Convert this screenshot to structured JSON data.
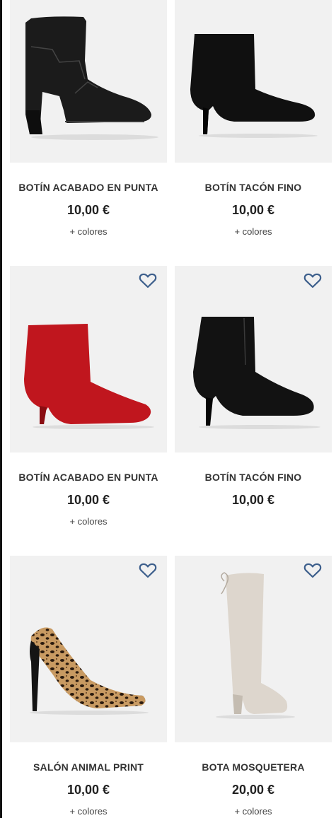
{
  "products": [
    {
      "name": "BOTÍN ACABADO EN PUNTA",
      "price": "10,00 €",
      "colors_label": "+ colores",
      "image": "black-cowboy-ankle-boot",
      "favorite_icon": false,
      "color": "#1a1a1a"
    },
    {
      "name": "BOTÍN TACÓN FINO",
      "price": "10,00 €",
      "colors_label": "+ colores",
      "image": "black-suede-stiletto-ankle-boot",
      "favorite_icon": false,
      "color": "#111111"
    },
    {
      "name": "BOTÍN ACABADO EN PUNTA",
      "price": "10,00 €",
      "colors_label": "+ colores",
      "image": "red-suede-pointed-ankle-boot",
      "favorite_icon": true,
      "color": "#c0161e"
    },
    {
      "name": "BOTÍN TACÓN FINO",
      "price": "10,00 €",
      "colors_label": "",
      "image": "black-leather-stiletto-ankle-boot",
      "favorite_icon": true,
      "color": "#121212"
    },
    {
      "name": "SALÓN ANIMAL PRINT",
      "price": "10,00 €",
      "colors_label": "+ colores",
      "image": "leopard-print-pump",
      "favorite_icon": true,
      "color": "#b58a5a"
    },
    {
      "name": "BOTA MOSQUETERA",
      "price": "20,00 €",
      "colors_label": "+ colores",
      "image": "beige-over-the-knee-boot",
      "favorite_icon": true,
      "color": "#ddd6cd"
    }
  ],
  "accent_color": "#3d5f8c"
}
